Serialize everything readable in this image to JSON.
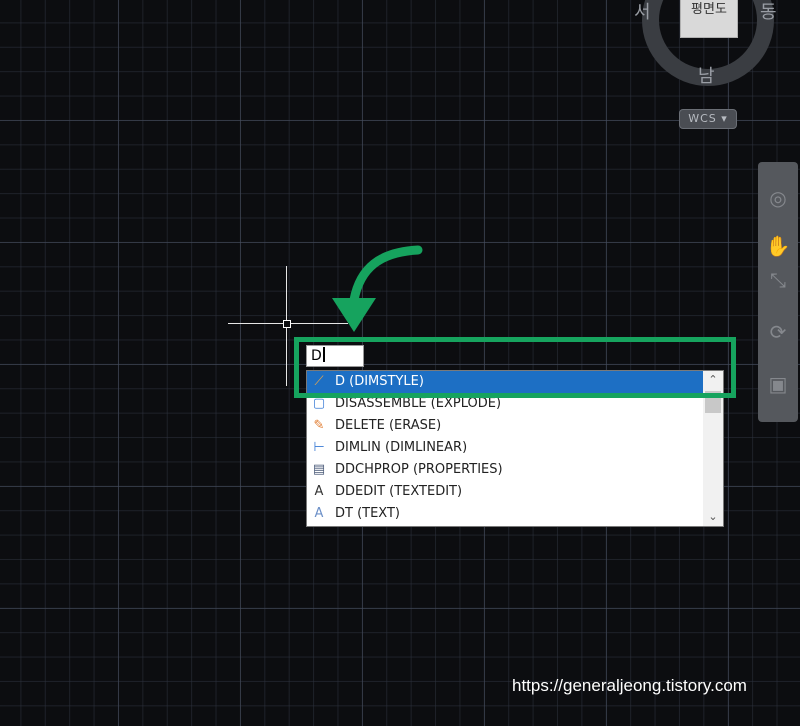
{
  "viewcube": {
    "face_label": "평면도",
    "west": "서",
    "east": "동",
    "south": "남",
    "coordinate_system": "WCS"
  },
  "command_input": {
    "value": "D"
  },
  "autocomplete": {
    "selected_index": 0,
    "items": [
      {
        "label": "D (DIMSTYLE)",
        "icon": "dimstyle-icon"
      },
      {
        "label": "DISASSEMBLE (EXPLODE)",
        "icon": "explode-icon"
      },
      {
        "label": "DELETE (ERASE)",
        "icon": "eraser-icon"
      },
      {
        "label": "DIMLIN (DIMLINEAR)",
        "icon": "dimlinear-icon"
      },
      {
        "label": "DDCHPROP (PROPERTIES)",
        "icon": "properties-icon"
      },
      {
        "label": "DDEDIT (TEXTEDIT)",
        "icon": "textedit-icon"
      },
      {
        "label": "DT (TEXT)",
        "icon": "text-icon"
      }
    ]
  },
  "watermark": "https://generaljeong.tistory.com",
  "colors": {
    "highlight_frame": "#16a35e",
    "selection": "#1d6fc4",
    "arrow": "#16a35e"
  }
}
